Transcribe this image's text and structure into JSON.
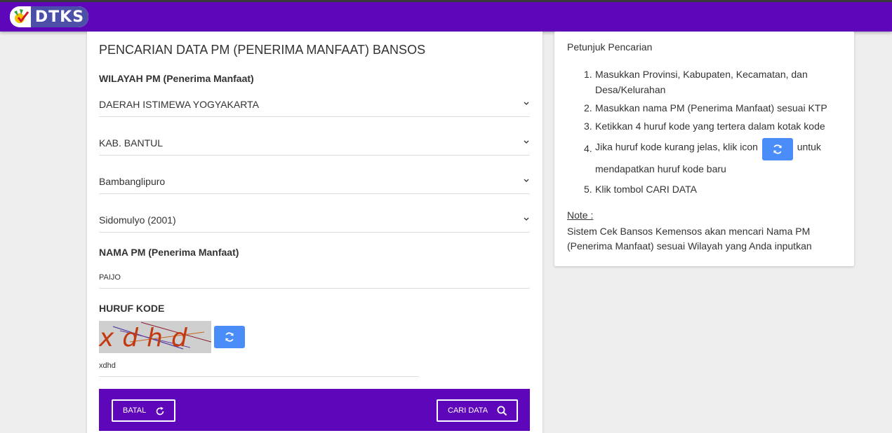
{
  "header": {
    "logo_text": "DTKS",
    "colors": {
      "navbar": "#5e06ba",
      "refresh_button": "#4a8df8"
    }
  },
  "form": {
    "title": "PENCARIAN DATA PM (PENERIMA MANFAAT) BANSOS",
    "wilayah_label": "WILAYAH PM (Penerima Manfaat)",
    "provinsi": "DAERAH ISTIMEWA YOGYAKARTA",
    "kabupaten": "KAB. BANTUL",
    "kecamatan": "Bambanglipuro",
    "desa": "Sidomulyo (2001)",
    "nama_label": "NAMA PM (Penerima Manfaat)",
    "nama_value": "PAIJO",
    "kode_label": "HURUF KODE",
    "captcha_text": "xdhd",
    "kode_value": "xdhd",
    "batal_label": "BATAL",
    "cari_label": "CARI DATA"
  },
  "help": {
    "title": "Petunjuk Pencarian",
    "steps": [
      {
        "num": "1.",
        "text": "Masukkan Provinsi, Kabupaten, Kecamatan, dan Desa/Kelurahan"
      },
      {
        "num": "2.",
        "text": "Masukkan nama PM (Penerima Manfaat) sesuai KTP"
      },
      {
        "num": "3.",
        "text": "Ketikkan 4 huruf kode yang tertera dalam kotak kode"
      },
      {
        "num": "4.",
        "text_before": "Jika huruf kode kurang jelas, klik icon",
        "text_after": "untuk mendapatkan huruf kode baru"
      },
      {
        "num": "5.",
        "text": "Klik tombol CARI DATA"
      }
    ],
    "note_label": "Note :",
    "note_text": "Sistem Cek Bansos Kemensos akan mencari Nama PM (Penerima Manfaat) sesuai Wilayah yang Anda inputkan"
  }
}
